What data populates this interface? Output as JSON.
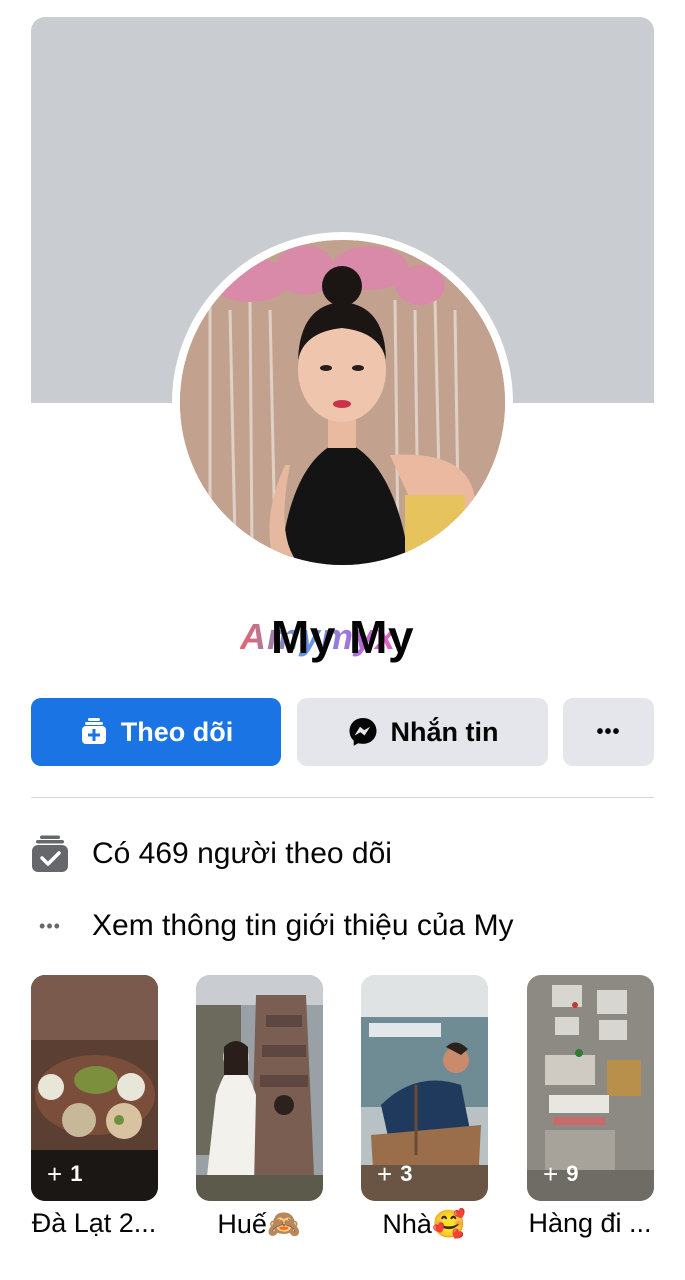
{
  "profile": {
    "name": "My My",
    "watermark": "Amymyx"
  },
  "actions": {
    "follow_label": "Theo dõi",
    "message_label": "Nhắn tin",
    "more_label": "•••"
  },
  "info": {
    "followers_text": "Có 469 người theo dõi",
    "about_text": "Xem thông tin giới thiệu của My",
    "about_icon_text": "•••"
  },
  "highlights": [
    {
      "label": "Đà Lạt 2...",
      "count": "1",
      "icon": "food-photo"
    },
    {
      "label": "Huế🙈",
      "count": "",
      "icon": "pagoda-photo"
    },
    {
      "label": "Nhà🥰",
      "count": "3",
      "icon": "craft-photo"
    },
    {
      "label": "Hàng đi ...",
      "count": "9",
      "icon": "products-photo"
    }
  ],
  "colors": {
    "accent": "#1b74e4",
    "cover": "#c9ccd1",
    "button_secondary": "#e4e6eb"
  }
}
